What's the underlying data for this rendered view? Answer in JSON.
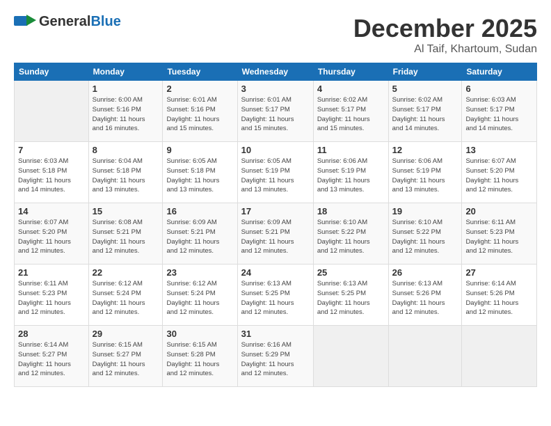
{
  "logo": {
    "general": "General",
    "blue": "Blue"
  },
  "title": "December 2025",
  "subtitle": "Al Taif, Khartoum, Sudan",
  "days_of_week": [
    "Sunday",
    "Monday",
    "Tuesday",
    "Wednesday",
    "Thursday",
    "Friday",
    "Saturday"
  ],
  "weeks": [
    [
      {
        "day": "",
        "info": ""
      },
      {
        "day": "1",
        "info": "Sunrise: 6:00 AM\nSunset: 5:16 PM\nDaylight: 11 hours\nand 16 minutes."
      },
      {
        "day": "2",
        "info": "Sunrise: 6:01 AM\nSunset: 5:16 PM\nDaylight: 11 hours\nand 15 minutes."
      },
      {
        "day": "3",
        "info": "Sunrise: 6:01 AM\nSunset: 5:17 PM\nDaylight: 11 hours\nand 15 minutes."
      },
      {
        "day": "4",
        "info": "Sunrise: 6:02 AM\nSunset: 5:17 PM\nDaylight: 11 hours\nand 15 minutes."
      },
      {
        "day": "5",
        "info": "Sunrise: 6:02 AM\nSunset: 5:17 PM\nDaylight: 11 hours\nand 14 minutes."
      },
      {
        "day": "6",
        "info": "Sunrise: 6:03 AM\nSunset: 5:17 PM\nDaylight: 11 hours\nand 14 minutes."
      }
    ],
    [
      {
        "day": "7",
        "info": "Sunrise: 6:03 AM\nSunset: 5:18 PM\nDaylight: 11 hours\nand 14 minutes."
      },
      {
        "day": "8",
        "info": "Sunrise: 6:04 AM\nSunset: 5:18 PM\nDaylight: 11 hours\nand 13 minutes."
      },
      {
        "day": "9",
        "info": "Sunrise: 6:05 AM\nSunset: 5:18 PM\nDaylight: 11 hours\nand 13 minutes."
      },
      {
        "day": "10",
        "info": "Sunrise: 6:05 AM\nSunset: 5:19 PM\nDaylight: 11 hours\nand 13 minutes."
      },
      {
        "day": "11",
        "info": "Sunrise: 6:06 AM\nSunset: 5:19 PM\nDaylight: 11 hours\nand 13 minutes."
      },
      {
        "day": "12",
        "info": "Sunrise: 6:06 AM\nSunset: 5:19 PM\nDaylight: 11 hours\nand 13 minutes."
      },
      {
        "day": "13",
        "info": "Sunrise: 6:07 AM\nSunset: 5:20 PM\nDaylight: 11 hours\nand 12 minutes."
      }
    ],
    [
      {
        "day": "14",
        "info": "Sunrise: 6:07 AM\nSunset: 5:20 PM\nDaylight: 11 hours\nand 12 minutes."
      },
      {
        "day": "15",
        "info": "Sunrise: 6:08 AM\nSunset: 5:21 PM\nDaylight: 11 hours\nand 12 minutes."
      },
      {
        "day": "16",
        "info": "Sunrise: 6:09 AM\nSunset: 5:21 PM\nDaylight: 11 hours\nand 12 minutes."
      },
      {
        "day": "17",
        "info": "Sunrise: 6:09 AM\nSunset: 5:21 PM\nDaylight: 11 hours\nand 12 minutes."
      },
      {
        "day": "18",
        "info": "Sunrise: 6:10 AM\nSunset: 5:22 PM\nDaylight: 11 hours\nand 12 minutes."
      },
      {
        "day": "19",
        "info": "Sunrise: 6:10 AM\nSunset: 5:22 PM\nDaylight: 11 hours\nand 12 minutes."
      },
      {
        "day": "20",
        "info": "Sunrise: 6:11 AM\nSunset: 5:23 PM\nDaylight: 11 hours\nand 12 minutes."
      }
    ],
    [
      {
        "day": "21",
        "info": "Sunrise: 6:11 AM\nSunset: 5:23 PM\nDaylight: 11 hours\nand 12 minutes."
      },
      {
        "day": "22",
        "info": "Sunrise: 6:12 AM\nSunset: 5:24 PM\nDaylight: 11 hours\nand 12 minutes."
      },
      {
        "day": "23",
        "info": "Sunrise: 6:12 AM\nSunset: 5:24 PM\nDaylight: 11 hours\nand 12 minutes."
      },
      {
        "day": "24",
        "info": "Sunrise: 6:13 AM\nSunset: 5:25 PM\nDaylight: 11 hours\nand 12 minutes."
      },
      {
        "day": "25",
        "info": "Sunrise: 6:13 AM\nSunset: 5:25 PM\nDaylight: 11 hours\nand 12 minutes."
      },
      {
        "day": "26",
        "info": "Sunrise: 6:13 AM\nSunset: 5:26 PM\nDaylight: 11 hours\nand 12 minutes."
      },
      {
        "day": "27",
        "info": "Sunrise: 6:14 AM\nSunset: 5:26 PM\nDaylight: 11 hours\nand 12 minutes."
      }
    ],
    [
      {
        "day": "28",
        "info": "Sunrise: 6:14 AM\nSunset: 5:27 PM\nDaylight: 11 hours\nand 12 minutes."
      },
      {
        "day": "29",
        "info": "Sunrise: 6:15 AM\nSunset: 5:27 PM\nDaylight: 11 hours\nand 12 minutes."
      },
      {
        "day": "30",
        "info": "Sunrise: 6:15 AM\nSunset: 5:28 PM\nDaylight: 11 hours\nand 12 minutes."
      },
      {
        "day": "31",
        "info": "Sunrise: 6:16 AM\nSunset: 5:29 PM\nDaylight: 11 hours\nand 12 minutes."
      },
      {
        "day": "",
        "info": ""
      },
      {
        "day": "",
        "info": ""
      },
      {
        "day": "",
        "info": ""
      }
    ]
  ]
}
